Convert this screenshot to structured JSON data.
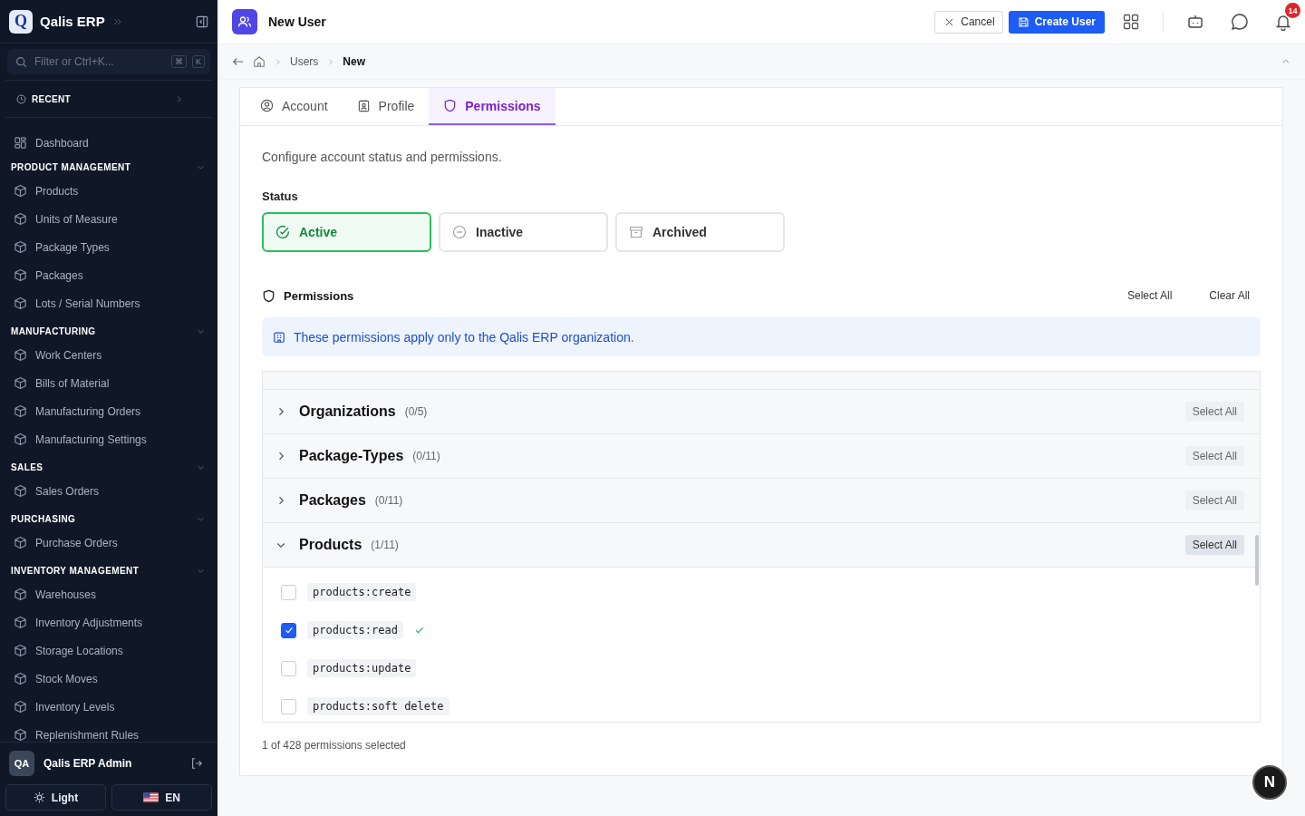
{
  "sidebar": {
    "brand": {
      "logo": "Q",
      "name": "Qalis ERP"
    },
    "search": {
      "placeholder": "Filter or Ctrl+K...",
      "keys": [
        "⌘",
        "K"
      ]
    },
    "recent": "RECENT",
    "items": [
      {
        "label": "Dashboard"
      }
    ],
    "groups": [
      {
        "title": "PRODUCT MANAGEMENT",
        "expanded": true,
        "items": [
          "Products",
          "Units of Measure",
          "Package Types",
          "Packages",
          "Lots / Serial Numbers"
        ]
      },
      {
        "title": "MANUFACTURING",
        "expanded": true,
        "items": [
          "Work Centers",
          "Bills of Material",
          "Manufacturing Orders",
          "Manufacturing Settings"
        ]
      },
      {
        "title": "SALES",
        "expanded": true,
        "items": [
          "Sales Orders"
        ]
      },
      {
        "title": "PURCHASING",
        "expanded": true,
        "items": [
          "Purchase Orders"
        ]
      },
      {
        "title": "INVENTORY MANAGEMENT",
        "expanded": true,
        "items": [
          "Warehouses",
          "Inventory Adjustments",
          "Storage Locations",
          "Stock Moves",
          "Inventory Levels",
          "Replenishment Rules"
        ]
      }
    ],
    "user": {
      "initials": "QA",
      "name": "Qalis ERP Admin"
    },
    "theme_button": "Light",
    "language_button": "EN"
  },
  "header": {
    "title": "New User",
    "cancel": "Cancel",
    "create": "Create User",
    "notification_count": "14"
  },
  "breadcrumb": [
    "Users",
    "New"
  ],
  "tabs": [
    {
      "label": "Account",
      "selected": false
    },
    {
      "label": "Profile",
      "selected": false
    },
    {
      "label": "Permissions",
      "selected": true
    }
  ],
  "description": "Configure account status and permissions.",
  "status": {
    "label": "Status",
    "options": [
      {
        "label": "Active",
        "selected": true
      },
      {
        "label": "Inactive",
        "selected": false
      },
      {
        "label": "Archived",
        "selected": false
      }
    ]
  },
  "permissions": {
    "title": "Permissions",
    "select_all": "Select All",
    "clear_all": "Clear All",
    "notice": "These permissions apply only to the Qalis ERP organization.",
    "groups": [
      {
        "name": "Organizations",
        "count": "(0/5)",
        "expanded": false,
        "select_all": "Select All"
      },
      {
        "name": "Package-Types",
        "count": "(0/11)",
        "expanded": false,
        "select_all": "Select All"
      },
      {
        "name": "Packages",
        "count": "(0/11)",
        "expanded": false,
        "select_all": "Select All"
      },
      {
        "name": "Products",
        "count": "(1/11)",
        "expanded": true,
        "select_all": "Select All",
        "items": [
          {
            "name": "products:create",
            "checked": false
          },
          {
            "name": "products:read",
            "checked": true
          },
          {
            "name": "products:update",
            "checked": false
          },
          {
            "name": "products:soft delete",
            "checked": false
          }
        ]
      }
    ],
    "summary": "1 of 428 permissions selected"
  },
  "assistant_button": "N"
}
